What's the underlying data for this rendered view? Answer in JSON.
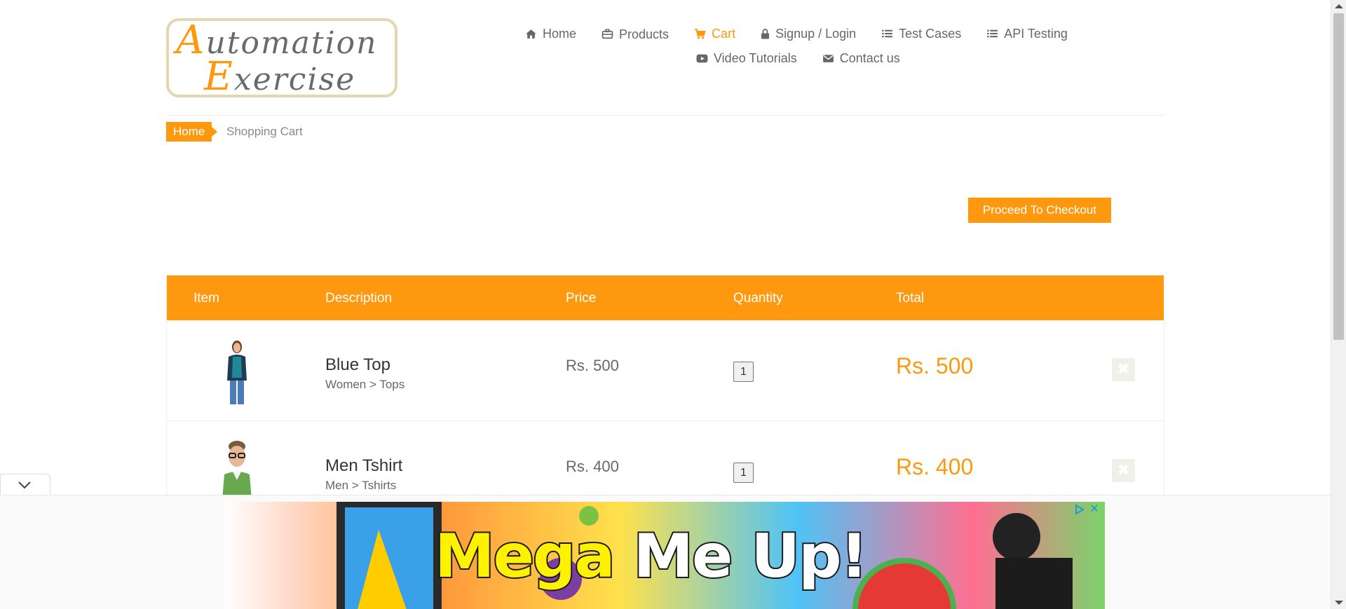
{
  "header": {
    "logo_line1_first": "A",
    "logo_line1_rest": "utomation",
    "logo_line2_first": "E",
    "logo_line2_rest": "xercise",
    "nav": [
      {
        "label": "Home",
        "icon": "home-icon"
      },
      {
        "label": "Products",
        "icon": "briefcase-icon"
      },
      {
        "label": "Cart",
        "icon": "cart-icon",
        "active": true
      },
      {
        "label": "Signup / Login",
        "icon": "lock-icon"
      },
      {
        "label": "Test Cases",
        "icon": "list-icon"
      },
      {
        "label": "API Testing",
        "icon": "list-icon"
      },
      {
        "label": "Video Tutorials",
        "icon": "youtube-play-icon"
      },
      {
        "label": "Contact us",
        "icon": "envelope-icon"
      }
    ]
  },
  "breadcrumb": {
    "home": "Home",
    "current": "Shopping Cart"
  },
  "checkout_button": "Proceed To Checkout",
  "cart_table": {
    "headers": [
      "Item",
      "Description",
      "Price",
      "Quantity",
      "Total"
    ],
    "rows": [
      {
        "name": "Blue Top",
        "category": "Women > Tops",
        "price": "Rs. 500",
        "quantity": "1",
        "total": "Rs. 500",
        "image": "woman-model-image"
      },
      {
        "name": "Men Tshirt",
        "category": "Men > Tshirts",
        "price": "Rs. 400",
        "quantity": "1",
        "total": "Rs. 400",
        "image": "man-model-image"
      }
    ]
  },
  "ad": {
    "headline_1": "Mega",
    "headline_2": "Me Up!"
  },
  "colors": {
    "accent": "#FE980F",
    "text": "#696763"
  }
}
